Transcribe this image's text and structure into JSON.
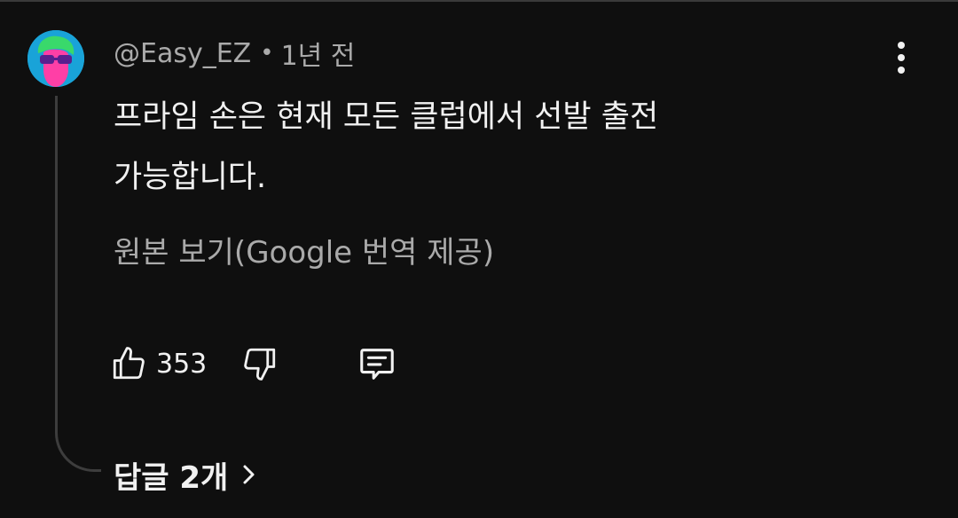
{
  "comment": {
    "author": "@Easy_EZ",
    "separator": "•",
    "time_ago": "1년 전",
    "body": "프라임 손은 현재 모든 클럽에서 선발 출전\n가능합니다.",
    "translation_link": "원본 보기(Google 번역 제공)",
    "like_count": "353",
    "replies_label": "답글 2개"
  },
  "icons": {
    "avatar": "avatar-image",
    "more": "more-vertical-icon",
    "like": "thumbs-up-icon",
    "dislike": "thumbs-down-icon",
    "reply": "comment-icon",
    "chevron": "chevron-right-icon"
  },
  "colors": {
    "background": "#0f0f0f",
    "primary_text": "#f1f1f1",
    "secondary_text": "#aaaaaa",
    "thread_line": "#3d3d3d",
    "avatar_bg": "#19a3d8",
    "avatar_face": "#ff3fa6",
    "avatar_hair": "#39d96b"
  }
}
